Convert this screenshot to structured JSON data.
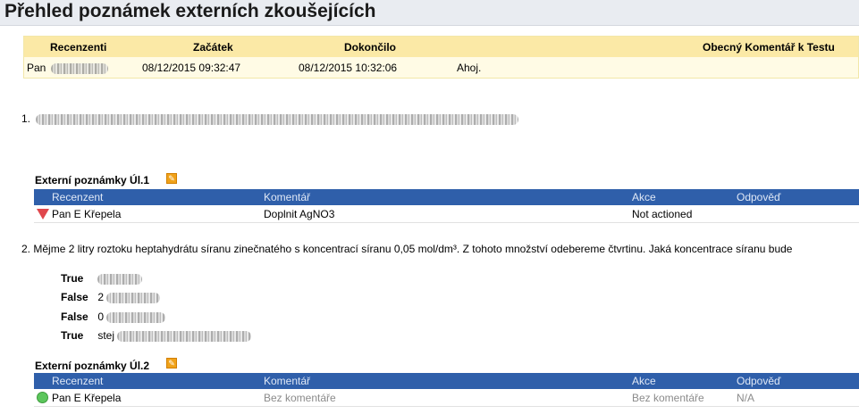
{
  "page": {
    "title": "Přehled poznámek externích zkoušejících"
  },
  "summary": {
    "headers": {
      "reviewers": "Recenzenti",
      "start": "Začátek",
      "end": "Dokončilo",
      "comment": "Obecný Komentář k Testu"
    },
    "row": {
      "reviewer": "Pan",
      "start": "08/12/2015 09:32:47",
      "end": "08/12/2015 10:32:06",
      "comment": "Ahoj."
    }
  },
  "questions": [
    {
      "number": "1.",
      "notes_title": "Externí poznámky Úl.1",
      "table": {
        "headers": {
          "reviewer": "Recenzent",
          "comment": "Komentář",
          "action": "Akce",
          "reply": "Odpověď"
        },
        "rows": [
          {
            "status": "down-triangle",
            "reviewer": "Pan E Křepela",
            "comment": "Doplnit AgNO3",
            "action": "Not actioned",
            "reply": ""
          }
        ]
      }
    },
    {
      "number": "2.",
      "text": "Mějme 2 litry roztoku heptahydrátu síranu zinečnatého s koncentrací síranu 0,05 mol/dm³. Z tohoto množství odebereme čtvrtinu. Jaká koncentrace síranu bude",
      "answers": [
        {
          "label": "True",
          "text": ""
        },
        {
          "label": "False",
          "text": "2"
        },
        {
          "label": "False",
          "text": "0"
        },
        {
          "label": "True",
          "text": "stej"
        }
      ],
      "notes_title": "Externí poznámky Úl.2",
      "table": {
        "headers": {
          "reviewer": "Recenzent",
          "comment": "Komentář",
          "action": "Akce",
          "reply": "Odpověď"
        },
        "rows": [
          {
            "status": "green-circle",
            "reviewer": "Pan E Křepela",
            "comment": "Bez komentáře",
            "action": "Bez komentáře",
            "reply": "N/A"
          }
        ]
      }
    }
  ],
  "colors": {
    "header_blue": "#2f5faa",
    "summary_header": "#fbe9a6",
    "title_bar": "#e9ecf1",
    "status_red": "#e0474c",
    "status_green": "#5cc65c"
  },
  "icons": {
    "edit": "pencil-edit-icon",
    "status_down": "red-down-triangle-icon",
    "status_ok": "green-circle-icon"
  }
}
